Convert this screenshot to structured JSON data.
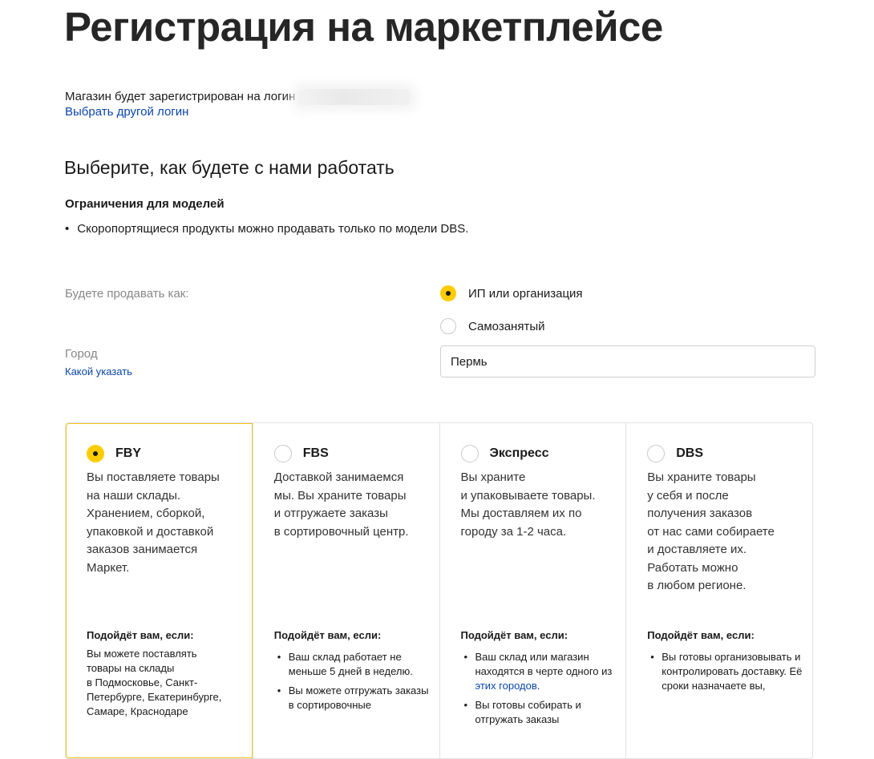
{
  "page": {
    "title": "Регистрация на маркетплейсе",
    "login_text": "Магазин будет зарегистрирован на логин",
    "change_login": "Выбрать другой логин"
  },
  "work": {
    "title": "Выберите, как будете с нами работать",
    "restrictions_title": "Ограничения для моделей",
    "restrictions": [
      "Скоропортящиеся продукты можно продавать только по модели DBS."
    ]
  },
  "seller": {
    "label": "Будете продавать как:",
    "options": [
      {
        "label": "ИП или организация",
        "selected": true
      },
      {
        "label": "Самозанятый",
        "selected": false
      }
    ]
  },
  "city": {
    "label": "Город",
    "hint": "Какой указать",
    "value": "Пермь"
  },
  "models": {
    "fit_title": "Подойдёт вам, если:",
    "cards": [
      {
        "name": "FBY",
        "selected": true,
        "description": [
          "Вы поставляете товары",
          "на наши склады.",
          "Хранением, сборкой,",
          "упаковкой и доставкой",
          "заказов занимается",
          "Маркет."
        ],
        "fit_text": [
          "Вы можете поставлять",
          "товары на склады",
          "в Подмосковье, Санкт-",
          "Петербурге, Екатеринбурге,",
          "Самаре, Краснодаре"
        ]
      },
      {
        "name": "FBS",
        "selected": false,
        "description": [
          "Доставкой занимаемся",
          "мы. Вы храните товары",
          "и отгружаете заказы",
          "в сортировочный центр."
        ],
        "fit_items": [
          "Ваш склад работает не меньше 5 дней в неделю.",
          "Вы можете отгружать заказы в сортировочные"
        ]
      },
      {
        "name": "Экспресс",
        "selected": false,
        "description": [
          "Вы храните",
          "и упаковываете товары.",
          "Мы доставляем их по",
          "городу за 1-2 часа."
        ],
        "fit_item_1_pre": "Ваш склад или магазин находятся в черте одного из ",
        "fit_item_1_link": "этих городов",
        "fit_item_1_post": ".",
        "fit_item_2": "Вы готовы собирать и отгружать заказы"
      },
      {
        "name": "DBS",
        "selected": false,
        "description": [
          "Вы храните товары",
          "у себя и после",
          "получения заказов",
          "от нас сами собираете",
          "и доставляете их.",
          "Работать можно",
          "в любом регионе."
        ],
        "fit_items": [
          "Вы готовы организовывать и контролировать доставку. Её сроки назначаете вы,"
        ]
      }
    ]
  },
  "colors": {
    "accent": "#ffcc00",
    "link": "#0a47a9",
    "active_border": "#f0c61c"
  }
}
